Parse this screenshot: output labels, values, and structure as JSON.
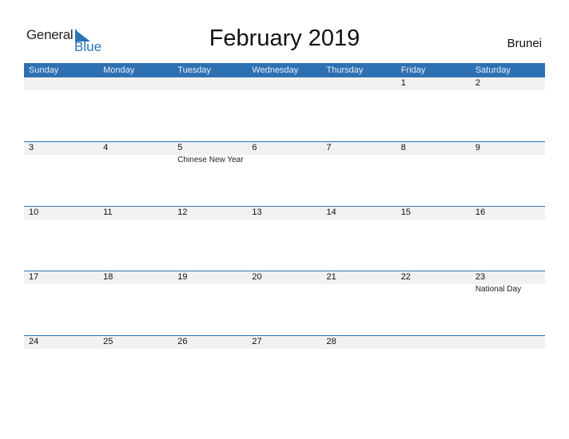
{
  "logo": {
    "part1": "General",
    "part2": "Blue",
    "accent": "#2e71b3"
  },
  "title": "February 2019",
  "country": "Brunei",
  "weekdays": [
    "Sunday",
    "Monday",
    "Tuesday",
    "Wednesday",
    "Thursday",
    "Friday",
    "Saturday"
  ],
  "weeks": [
    [
      {
        "day": ""
      },
      {
        "day": ""
      },
      {
        "day": ""
      },
      {
        "day": ""
      },
      {
        "day": ""
      },
      {
        "day": "1"
      },
      {
        "day": "2"
      }
    ],
    [
      {
        "day": "3"
      },
      {
        "day": "4"
      },
      {
        "day": "5",
        "event": "Chinese New Year"
      },
      {
        "day": "6"
      },
      {
        "day": "7"
      },
      {
        "day": "8"
      },
      {
        "day": "9"
      }
    ],
    [
      {
        "day": "10"
      },
      {
        "day": "11"
      },
      {
        "day": "12"
      },
      {
        "day": "13"
      },
      {
        "day": "14"
      },
      {
        "day": "15"
      },
      {
        "day": "16"
      }
    ],
    [
      {
        "day": "17"
      },
      {
        "day": "18"
      },
      {
        "day": "19"
      },
      {
        "day": "20"
      },
      {
        "day": "21"
      },
      {
        "day": "22"
      },
      {
        "day": "23",
        "event": "National Day"
      }
    ],
    [
      {
        "day": "24"
      },
      {
        "day": "25"
      },
      {
        "day": "26"
      },
      {
        "day": "27"
      },
      {
        "day": "28"
      },
      {
        "day": ""
      },
      {
        "day": ""
      }
    ]
  ]
}
